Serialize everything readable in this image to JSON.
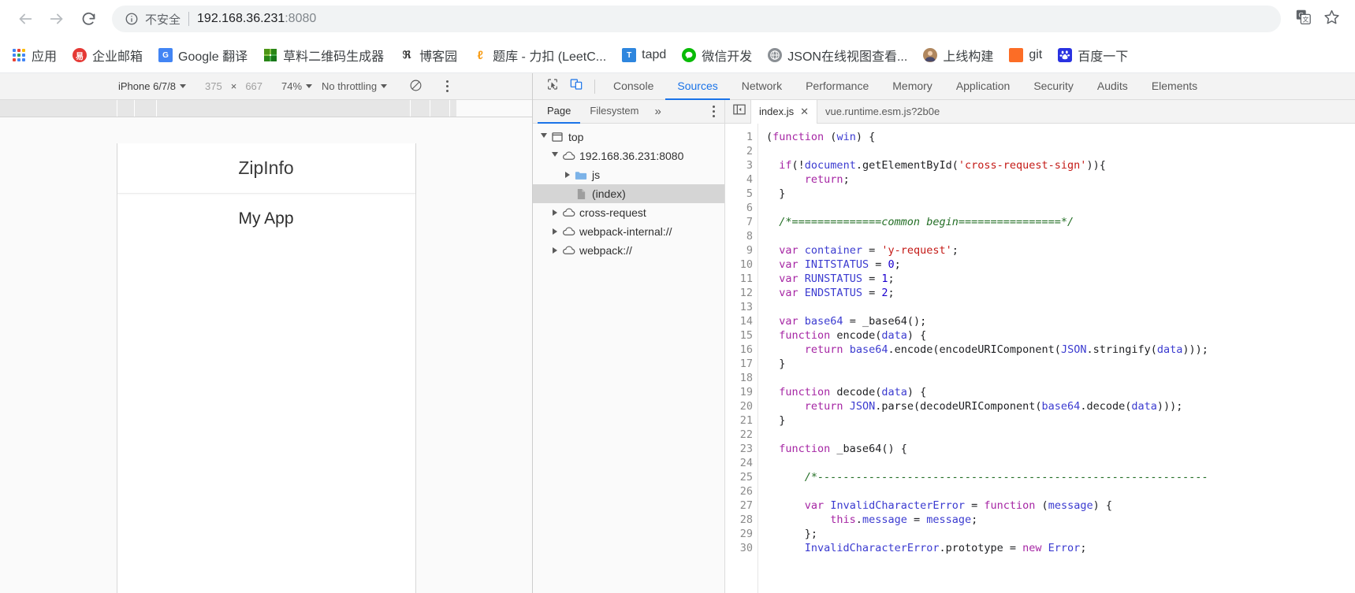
{
  "browser": {
    "back_icon": "back-arrow-icon",
    "forward_icon": "forward-arrow-icon",
    "reload_icon": "reload-icon",
    "security_label": "不安全",
    "url_host": "192.168.36.231",
    "url_port": ":8080",
    "translate_icon": "translate-icon",
    "bookmark_icon": "star-icon"
  },
  "bookmarks": [
    {
      "label": "应用",
      "icon": "apps-grid-icon"
    },
    {
      "label": "企业邮箱",
      "icon": "qiye-mail-icon",
      "glyph": "易"
    },
    {
      "label": "Google 翻译",
      "icon": "google-translate-icon",
      "glyph": "G"
    },
    {
      "label": "草料二维码生成器",
      "icon": "caoliao-qrcode-icon",
      "glyph": ""
    },
    {
      "label": "博客园",
      "icon": "cnblogs-icon",
      "glyph": "ℜ"
    },
    {
      "label": "题库 - 力扣 (LeetC...",
      "icon": "leetcode-icon",
      "glyph": "ℓ"
    },
    {
      "label": "tapd",
      "icon": "tapd-icon",
      "glyph": "T"
    },
    {
      "label": "微信开发",
      "icon": "wechat-icon",
      "glyph": ""
    },
    {
      "label": "JSON在线视图查看...",
      "icon": "json-globe-icon",
      "glyph": ""
    },
    {
      "label": "上线构建",
      "icon": "build-avatar-icon",
      "glyph": ""
    },
    {
      "label": "git",
      "icon": "gitlab-icon",
      "glyph": ""
    },
    {
      "label": "百度一下",
      "icon": "baidu-icon",
      "glyph": "熊"
    }
  ],
  "device_toolbar": {
    "device": "iPhone 6/7/8",
    "width": "375",
    "times": "×",
    "height": "667",
    "zoom": "74%",
    "throttling": "No throttling",
    "rotate_icon": "rotate-device-icon",
    "more_icon": "more-options-icon"
  },
  "device_preview": {
    "app_title": "ZipInfo",
    "app_body": "My App"
  },
  "devtools": {
    "inspect_icon": "inspect-element-icon",
    "device_toggle_icon": "toggle-device-toolbar-icon",
    "tabs": [
      {
        "label": "Console",
        "selected": false
      },
      {
        "label": "Sources",
        "selected": true
      },
      {
        "label": "Network",
        "selected": false
      },
      {
        "label": "Performance",
        "selected": false
      },
      {
        "label": "Memory",
        "selected": false
      },
      {
        "label": "Application",
        "selected": false
      },
      {
        "label": "Security",
        "selected": false
      },
      {
        "label": "Audits",
        "selected": false
      },
      {
        "label": "Elements",
        "selected": false
      }
    ],
    "nav_tabs": [
      {
        "label": "Page",
        "selected": true
      },
      {
        "label": "Filesystem",
        "selected": false
      }
    ],
    "nav_more": "»",
    "nav_kebab_icon": "navigator-more-icon",
    "tree": [
      {
        "label": "top",
        "icon": "frame-icon",
        "indent": 0,
        "state": "open",
        "selected": false
      },
      {
        "label": "192.168.36.231:8080",
        "icon": "cloud-icon",
        "indent": 1,
        "state": "open",
        "selected": false
      },
      {
        "label": "js",
        "icon": "folder-icon",
        "indent": 2,
        "state": "closed",
        "selected": false
      },
      {
        "label": "(index)",
        "icon": "file-icon",
        "indent": 2,
        "state": "leaf",
        "selected": true
      },
      {
        "label": "cross-request",
        "icon": "cloud-icon",
        "indent": 1,
        "state": "closed",
        "selected": false
      },
      {
        "label": "webpack-internal://",
        "icon": "cloud-icon",
        "indent": 1,
        "state": "closed",
        "selected": false
      },
      {
        "label": "webpack://",
        "icon": "cloud-icon",
        "indent": 1,
        "state": "closed",
        "selected": false
      }
    ],
    "panel_toggle_icon": "show-navigator-icon",
    "file_tabs": [
      {
        "label": "index.js",
        "active": true,
        "close": "✕"
      },
      {
        "label": "vue.runtime.esm.js?2b0e",
        "active": false,
        "close": ""
      }
    ]
  },
  "editor": {
    "line_numbers": [
      "1",
      "2",
      "3",
      "4",
      "5",
      "6",
      "7",
      "8",
      "9",
      "10",
      "11",
      "12",
      "13",
      "14",
      "15",
      "16",
      "17",
      "18",
      "19",
      "20",
      "21",
      "22",
      "23",
      "24",
      "25",
      "26",
      "27",
      "28",
      "29",
      "30"
    ],
    "lines": [
      "(function (win) {",
      "",
      "  if(!document.getElementById('cross-request-sign')){",
      "      return;",
      "  }",
      "",
      "  /*==============common begin================*/",
      "",
      "  var container = 'y-request';",
      "  var INITSTATUS = 0;",
      "  var RUNSTATUS = 1;",
      "  var ENDSTATUS = 2;",
      "",
      "  var base64 = _base64();",
      "  function encode(data) {",
      "      return base64.encode(encodeURIComponent(JSON.stringify(data)));",
      "  }",
      "",
      "  function decode(data) {",
      "      return JSON.parse(decodeURIComponent(base64.decode(data)));",
      "  }",
      "",
      "  function _base64() {",
      "",
      "      /*-------------------------------------------------------------",
      "",
      "      var InvalidCharacterError = function (message) {",
      "          this.message = message;",
      "      };",
      "      InvalidCharacterError.prototype = new Error;"
    ]
  },
  "colors": {
    "accent": "#1a73e8",
    "keyword": "#a626a4",
    "string": "#c41a16",
    "number": "#1c00cf",
    "comment": "#236e25",
    "identifier": "#3b3bd0"
  }
}
